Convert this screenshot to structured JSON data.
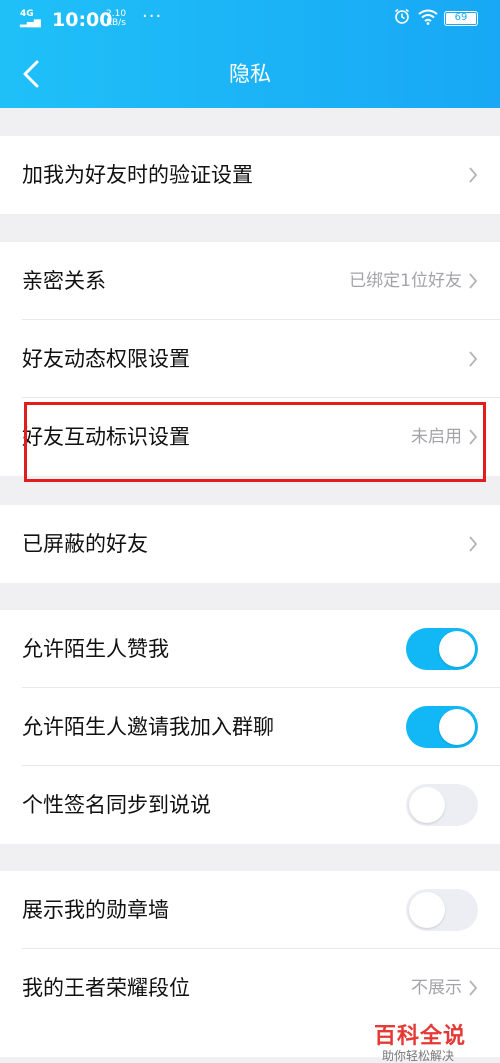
{
  "status_bar": {
    "signal": "4G",
    "time": "10:00",
    "speed_value": "2.10",
    "speed_unit": "KB/s",
    "dots": "···",
    "battery": "69"
  },
  "header": {
    "title": "隐私"
  },
  "sections": [
    {
      "rows": [
        {
          "label": "加我为好友时的验证设置",
          "value": ""
        }
      ]
    },
    {
      "rows": [
        {
          "label": "亲密关系",
          "value": "已绑定1位好友"
        },
        {
          "label": "好友动态权限设置",
          "value": ""
        },
        {
          "label": "好友互动标识设置",
          "value": "未启用"
        }
      ]
    },
    {
      "rows": [
        {
          "label": "已屏蔽的好友",
          "value": ""
        }
      ]
    },
    {
      "rows": [
        {
          "label": "允许陌生人赞我",
          "toggle": "on"
        },
        {
          "label": "允许陌生人邀请我加入群聊",
          "toggle": "on"
        },
        {
          "label": "个性签名同步到说说",
          "toggle": "off"
        }
      ]
    },
    {
      "rows": [
        {
          "label": "展示我的勋章墙",
          "toggle": "off"
        },
        {
          "label": "我的王者荣耀段位",
          "value": "不展示"
        }
      ]
    }
  ],
  "colors": {
    "accent": "#12b7f5",
    "highlight": "#e11d1d"
  },
  "watermark": {
    "line1": "百科全说",
    "line2": "助你轻松解决"
  }
}
